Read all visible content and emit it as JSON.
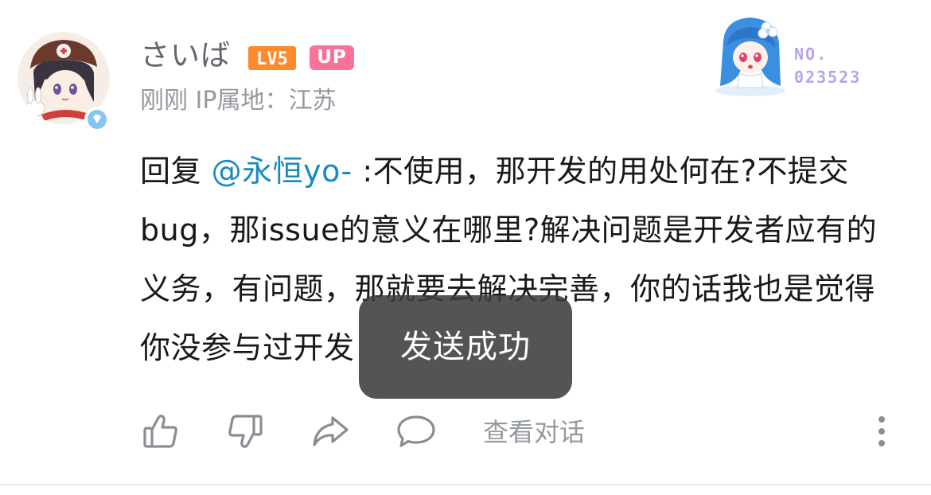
{
  "comment": {
    "author": {
      "name": "さいば",
      "level_badge": "LV5",
      "up_badge": "UP"
    },
    "meta": {
      "time": "刚刚",
      "ip_location": "IP属地：江苏"
    },
    "fan_card": {
      "label": "NO.",
      "number": "023523"
    },
    "body": {
      "reply_prefix": "回复",
      "mention": "@永恒yo-",
      "text": ":不使用，那开发的用处何在?不提交bug，那issue的意义在哪里?解决问题是开发者应有的义务，有问题，那就要去解决完善，你的话我也是觉得你没参与过开发"
    },
    "actions": {
      "like_icon": "thumbs-up-icon",
      "dislike_icon": "thumbs-down-icon",
      "share_icon": "share-icon",
      "reply_icon": "comment-icon",
      "view_conversation": "查看对话",
      "more_icon": "more-vertical-icon"
    }
  },
  "toast": {
    "message": "发送成功"
  },
  "colors": {
    "mention": "#178bbf",
    "up_badge": "#fb7299",
    "level_badge": "#ff8a2b",
    "fan_number": "#b7a4ea",
    "secondary_text": "#9499a0"
  }
}
